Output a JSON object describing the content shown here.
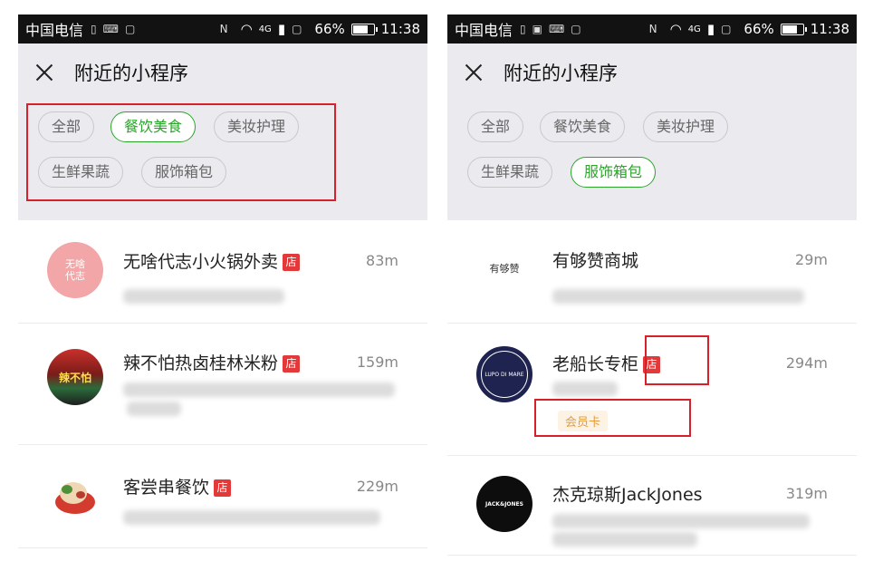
{
  "status": {
    "carrier": "中国电信",
    "icons_left": [
      "sim-icon",
      "keyboard-icon",
      "notification-icon"
    ],
    "icons_right": [
      "nfc-icon",
      "wifi-icon",
      "signal-icon",
      "sim-card-icon"
    ],
    "network": "4G",
    "battery": "66%",
    "battery_level": 0.66,
    "time": "11:38"
  },
  "left": {
    "title": "附近的小程序",
    "chips": [
      "全部",
      "餐饮美食",
      "美妆护理",
      "生鲜果蔬",
      "服饰箱包"
    ],
    "active_chip": "餐饮美食",
    "items": [
      {
        "name": "无啥代志小火锅外卖",
        "badge": "店",
        "distance": "83m"
      },
      {
        "name": "辣不怕热卤桂林米粉",
        "badge": "店",
        "distance": "159m"
      },
      {
        "name": "客尝串餐饮",
        "badge": "店",
        "distance": "229m"
      }
    ]
  },
  "right": {
    "title": "附近的小程序",
    "chips": [
      "全部",
      "餐饮美食",
      "美妆护理",
      "生鲜果蔬",
      "服饰箱包"
    ],
    "active_chip": "服饰箱包",
    "items": [
      {
        "name": "有够赞商城",
        "distance": "29m",
        "logo_text": "有够赞"
      },
      {
        "name": "老船长专柜",
        "badge": "店",
        "distance": "294m",
        "tag": "会员卡",
        "logo_text": "LUPO DI MARE"
      },
      {
        "name": "杰克琼斯JackJones",
        "distance": "319m",
        "logo_text": "JACK&JONES"
      }
    ]
  },
  "colors": {
    "accent_green": "#2aa52a",
    "highlight_red": "#d8202a",
    "badge_red": "#e23a3a",
    "member_orange": "#e89b3a"
  }
}
